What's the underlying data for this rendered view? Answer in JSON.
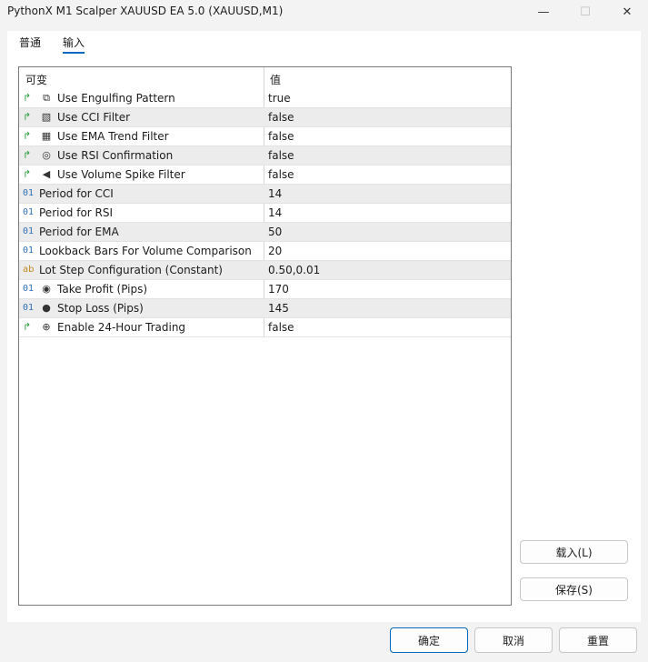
{
  "window": {
    "title": "PythonX M1 Scalper XAUUSD EA 5.0 (XAUUSD,M1)",
    "minimize_glyph": "—",
    "maximize_glyph": "☐",
    "close_glyph": "✕"
  },
  "tabs": [
    {
      "label": "普通",
      "active": false
    },
    {
      "label": "输入",
      "active": true
    }
  ],
  "grid": {
    "headers": {
      "variable": "可变",
      "value": "值"
    },
    "rows": [
      {
        "type_icon": "bool-arrow-icon",
        "type_glyph": "↱",
        "sub_icon": "engulfing-icon",
        "sub_glyph": "⧉",
        "name": "Use Engulfing Pattern",
        "value": "true"
      },
      {
        "type_icon": "bool-arrow-icon",
        "type_glyph": "↱",
        "sub_icon": "cci-icon",
        "sub_glyph": "▧",
        "name": "Use CCI Filter",
        "value": "false"
      },
      {
        "type_icon": "bool-arrow-icon",
        "type_glyph": "↱",
        "sub_icon": "ema-chart-icon",
        "sub_glyph": "▦",
        "name": "Use EMA Trend Filter",
        "value": "false"
      },
      {
        "type_icon": "bool-arrow-icon",
        "type_glyph": "↱",
        "sub_icon": "rsi-spiral-icon",
        "sub_glyph": "◎",
        "name": "Use RSI Confirmation",
        "value": "false"
      },
      {
        "type_icon": "bool-arrow-icon",
        "type_glyph": "↱",
        "sub_icon": "speaker-icon",
        "sub_glyph": "◀",
        "name": "Use Volume Spike Filter",
        "value": "false"
      },
      {
        "type_icon": "int-icon",
        "type_glyph": "01",
        "sub_icon": "",
        "sub_glyph": "",
        "name": "Period for CCI",
        "value": "14"
      },
      {
        "type_icon": "int-icon",
        "type_glyph": "01",
        "sub_icon": "",
        "sub_glyph": "",
        "name": "Period for RSI",
        "value": "14"
      },
      {
        "type_icon": "int-icon",
        "type_glyph": "01",
        "sub_icon": "",
        "sub_glyph": "",
        "name": "Period for EMA",
        "value": "50"
      },
      {
        "type_icon": "int-icon",
        "type_glyph": "01",
        "sub_icon": "",
        "sub_glyph": "",
        "name": "Lookback Bars For Volume Comparison",
        "value": "20"
      },
      {
        "type_icon": "string-icon",
        "type_glyph": "ab",
        "sub_icon": "",
        "sub_glyph": "",
        "name": "Lot Step Configuration (Constant)",
        "value": "0.50,0.01"
      },
      {
        "type_icon": "int-icon",
        "type_glyph": "01",
        "sub_icon": "target-icon",
        "sub_glyph": "◉",
        "name": "Take Profit (Pips)",
        "value": "170"
      },
      {
        "type_icon": "int-icon",
        "type_glyph": "01",
        "sub_icon": "stop-circle-icon",
        "sub_glyph": "●",
        "name": "Stop Loss (Pips)",
        "value": "145"
      },
      {
        "type_icon": "bool-arrow-icon",
        "type_glyph": "↱",
        "sub_icon": "globe-icon",
        "sub_glyph": "⊕",
        "name": "Enable 24-Hour Trading",
        "value": "false"
      }
    ]
  },
  "side_buttons": {
    "load": "载入(L)",
    "save": "保存(S)"
  },
  "bottom_buttons": {
    "ok": "确定",
    "cancel": "取消",
    "reset": "重置"
  }
}
